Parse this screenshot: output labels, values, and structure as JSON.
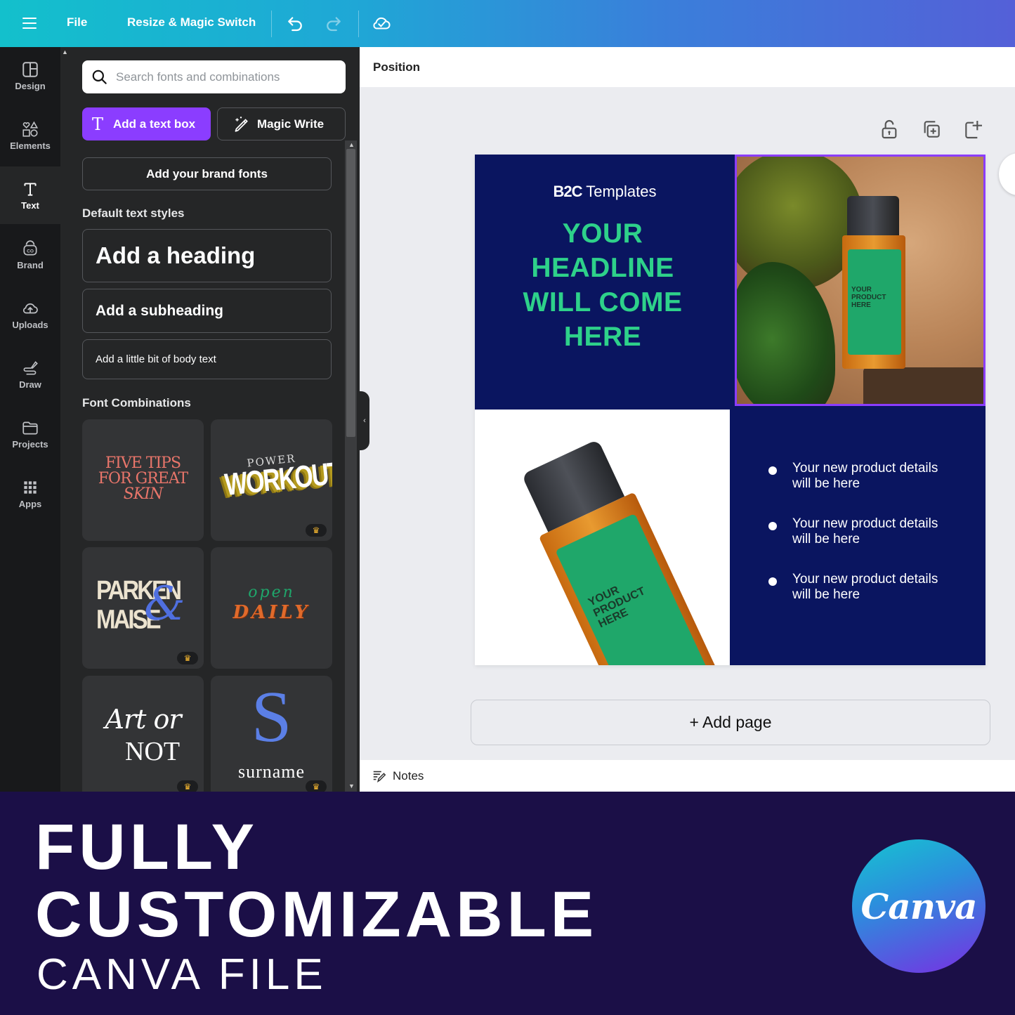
{
  "topbar": {
    "menu_icon": "hamburger-icon",
    "file_label": "File",
    "resize_label": "Resize & Magic Switch",
    "undo_icon": "undo-icon",
    "redo_icon": "redo-icon",
    "save_status_icon": "cloud-check-icon"
  },
  "rail": {
    "items": [
      {
        "label": "Design",
        "icon": "layout-icon",
        "active": false
      },
      {
        "label": "Elements",
        "icon": "shapes-icon",
        "active": false
      },
      {
        "label": "Text",
        "icon": "text-icon",
        "active": true
      },
      {
        "label": "Brand",
        "icon": "brand-icon",
        "active": false
      },
      {
        "label": "Uploads",
        "icon": "cloud-upload-icon",
        "active": false
      },
      {
        "label": "Draw",
        "icon": "draw-icon",
        "active": false
      },
      {
        "label": "Projects",
        "icon": "folder-icon",
        "active": false
      },
      {
        "label": "Apps",
        "icon": "apps-grid-icon",
        "active": false
      }
    ]
  },
  "panel": {
    "search_placeholder": "Search fonts and combinations",
    "search_value": "",
    "add_text_box_label": "Add a text box",
    "magic_write_label": "Magic Write",
    "brand_fonts_label": "Add your brand fonts",
    "default_styles_title": "Default text styles",
    "heading_label": "Add a heading",
    "subheading_label": "Add a subheading",
    "body_label": "Add a little bit of body text",
    "combos_title": "Font Combinations",
    "combos": [
      {
        "line1": "FIVE TIPS",
        "line2": "FOR GREAT",
        "line3": "SKIN",
        "pro": false,
        "color": "#e8756a"
      },
      {
        "line1": "POWER",
        "line2": "WORKOUT",
        "pro": true,
        "color": "#ffffff",
        "accent": "#b49a1e"
      },
      {
        "line1": "PARKEN",
        "line2": "MAISE",
        "amp": "&",
        "pro": true,
        "color": "#ece3cf",
        "accent": "#4f6fe0"
      },
      {
        "line1": "open",
        "line2": "DAILY",
        "pro": false,
        "color": "#1fa66b",
        "accent": "#e06a2b"
      },
      {
        "line1": "Art or",
        "line2": "NOT",
        "pro": true,
        "color": "#ffffff"
      },
      {
        "line1": "S",
        "line2": "surname",
        "pro": true,
        "color": "#5b7fe6"
      }
    ]
  },
  "canvas": {
    "position_label": "Position",
    "tools": [
      "lock-icon",
      "duplicate-page-icon",
      "add-page-icon"
    ],
    "design": {
      "logo_mark": "B2C",
      "logo_text": "Templates",
      "headline": "YOUR HEADLINE WILL COME HERE",
      "headline_lines": [
        "YOUR",
        "HEADLINE",
        "WILL COME",
        "HERE"
      ],
      "product_label_lines": [
        "YOUR",
        "PRODUCT",
        "HERE"
      ],
      "bullets": [
        "Your new product details will be here",
        "Your new product details will be here",
        "Your new product details will be here"
      ],
      "colors": {
        "navy": "#0a1560",
        "green": "#2ed18a",
        "selection": "#8b3dff"
      }
    },
    "add_page_label": "+ Add page",
    "notes_label": "Notes"
  },
  "banner": {
    "line1": "FULLY",
    "line2": "CUSTOMIZABLE",
    "line3": "CANVA FILE",
    "logo_text": "Canva"
  }
}
